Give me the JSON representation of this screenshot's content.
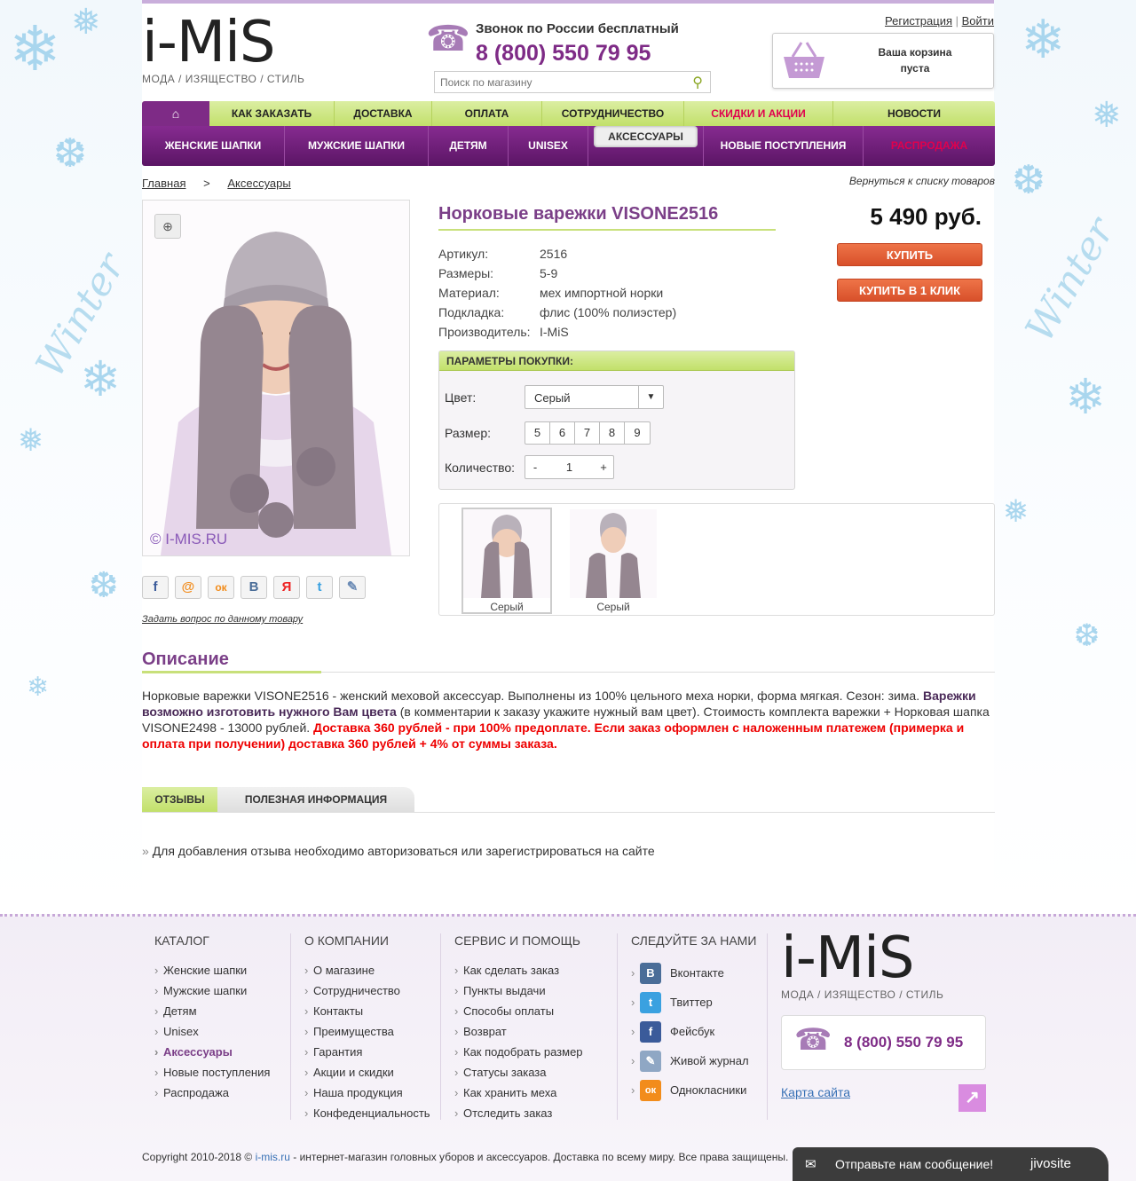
{
  "header": {
    "logo_text": "i-MiS",
    "logo_tagline": "МОДА / ИЗЯЩЕСТВО / СТИЛЬ",
    "call_label": "Звонок по России бесплатный",
    "phone": "8 (800) 550 79 95",
    "search_placeholder": "Поиск по магазину",
    "register": "Регистрация",
    "separator": "|",
    "login": "Войти",
    "cart_text_line1": "Ваша корзина",
    "cart_text_line2": "пуста"
  },
  "nav_top": [
    "КАК ЗАКАЗАТЬ",
    "ДОСТАВКА",
    "ОПЛАТА",
    "СОТРУДНИЧЕСТВО",
    "СКИДКИ И АКЦИИ",
    "НОВОСТИ"
  ],
  "nav_bottom": [
    "ЖЕНСКИЕ ШАПКИ",
    "МУЖСКИЕ ШАПКИ",
    "ДЕТЯМ",
    "UNISEX",
    "АКСЕССУАРЫ",
    "НОВЫЕ ПОСТУПЛЕНИЯ",
    "РАСПРОДАЖА"
  ],
  "colors": {
    "accent": "#7e2b86",
    "green": "#c2e06a",
    "sale": "#e0004d",
    "buy": "#e0602f"
  },
  "breadcrumb": {
    "home": "Главная",
    "sep": ">",
    "current": "Аксессуары",
    "back": "Вернуться к списку товаров"
  },
  "product": {
    "title": "Норковые варежки VISONE2516",
    "price": "5 490 руб.",
    "buy": "КУПИТЬ",
    "buy_one_click": "КУПИТЬ В 1 КЛИК",
    "watermark": "© I-MIS.RU",
    "specs": [
      {
        "k": "Артикул:",
        "v": "2516"
      },
      {
        "k": "Размеры:",
        "v": "5-9"
      },
      {
        "k": "Материал:",
        "v": "мех импортной норки"
      },
      {
        "k": "Подкладка:",
        "v": "флис (100% полиэстер)"
      },
      {
        "k": "Производитель:",
        "v": "I-MiS"
      }
    ],
    "ask": "Задать вопрос по данному товару"
  },
  "params": {
    "header": "ПАРАМЕТРЫ ПОКУПКИ:",
    "color_label": "Цвет:",
    "color_value": "Серый",
    "size_label": "Размер:",
    "sizes": [
      "5",
      "6",
      "7",
      "8",
      "9"
    ],
    "qty_label": "Количество:",
    "qty_minus": "-",
    "qty_value": "1",
    "qty_plus": "+"
  },
  "thumbs": [
    {
      "label": "Серый"
    },
    {
      "label": "Серый"
    }
  ],
  "share_icons": [
    "facebook-icon",
    "mail-icon",
    "odnoklassniki-icon",
    "vk-icon",
    "yandex-icon",
    "twitter-icon",
    "livejournal-icon"
  ],
  "share_glyphs": [
    "f",
    "@",
    "ок",
    "В",
    "Я",
    "t",
    "✎"
  ],
  "description": {
    "title": "Описание",
    "p1": "Норковые варежки VISONE2516 - женский меховой аксессуар. Выполнены из 100% цельного меха норки, форма мягкая. Сезон: зима. ",
    "p2": "Варежки возможно изготовить нужного Вам цвета",
    "p3": " (в комментарии к заказу укажите нужный вам цвет). Стоимость комплекта варежки + Норковая шапка VISONE2498 - 13000 рублей. ",
    "p4": "Доставка 360 рублей - при 100% предоплате. Если заказ оформлен с наложенным платежем (примерка и оплата при получении) доставка 360 рублей + 4% от суммы заказа."
  },
  "tabs": {
    "reviews": "ОТЗЫВЫ",
    "info": "ПОЛЕЗНАЯ ИНФОРМАЦИЯ",
    "review_note": "Для добавления отзыва необходимо авторизоваться или зарегистрироваться на сайте",
    "bullet": "»"
  },
  "footer": {
    "catalog_title": "КАТАЛОГ",
    "catalog": [
      "Женские шапки",
      "Мужские шапки",
      "Детям",
      "Unisex",
      "Аксессуары",
      "Новые поступления",
      "Распродажа"
    ],
    "company_title": "О КОМПАНИИ",
    "company": [
      "О магазине",
      "Сотрудничество",
      "Контакты",
      "Преимущества",
      "Гарантия",
      "Акции и скидки",
      "Наша продукция",
      "Конфеденциальность"
    ],
    "service_title": "СЕРВИС И ПОМОЩЬ",
    "service": [
      "Как сделать заказ",
      "Пункты выдачи",
      "Способы оплаты",
      "Возврат",
      "Как подобрать размер",
      "Статусы заказа",
      "Как хранить меха",
      "Отследить заказ"
    ],
    "follow_title": "СЛЕДУЙТЕ ЗА НАМИ",
    "follow": [
      {
        "label": "Вконтакте",
        "glyph": "В",
        "color": "#4a6d98"
      },
      {
        "label": "Твиттер",
        "glyph": "t",
        "color": "#3aa1e0"
      },
      {
        "label": "Фейсбук",
        "glyph": "f",
        "color": "#3b5b9a"
      },
      {
        "label": "Живой журнал",
        "glyph": "✎",
        "color": "#8fa7c4"
      },
      {
        "label": "Однокласники",
        "glyph": "ок",
        "color": "#f28c1b"
      }
    ],
    "phone": "8 (800) 550 79 95",
    "sitemap": "Карта сайта",
    "copyright_pre": "Copyright 2010-2018 © ",
    "copyright_link": "i-mis.ru",
    "copyright_post": " - интернет-магазин головных уборов и аксессуаров. Доставка по всему миру. Все права защищены."
  },
  "chat": {
    "text": "Отправьте нам сообщение!",
    "brand": "jivosite"
  }
}
